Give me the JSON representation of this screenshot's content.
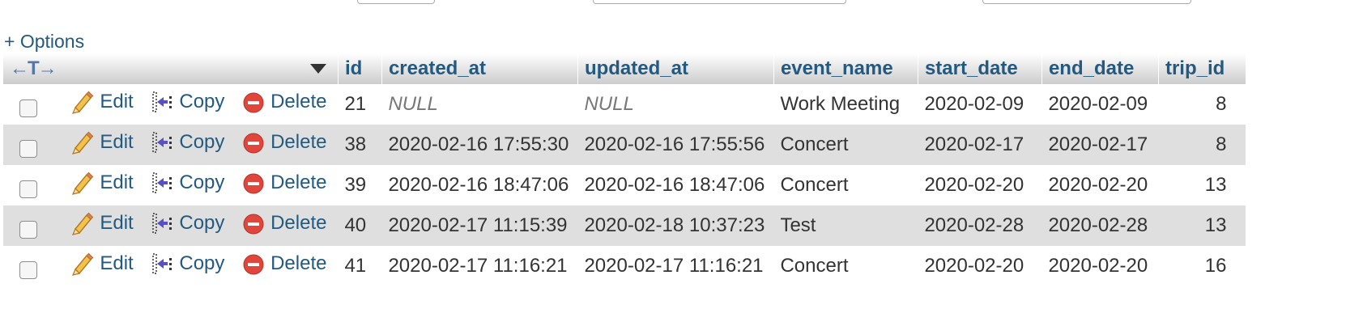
{
  "options_label": "+ Options",
  "headers": {
    "id": "id",
    "created_at": "created_at",
    "updated_at": "updated_at",
    "event_name": "event_name",
    "start_date": "start_date",
    "end_date": "end_date",
    "trip_id": "trip_id"
  },
  "actions": {
    "edit": "Edit",
    "copy": "Copy",
    "delete": "Delete"
  },
  "rows": [
    {
      "id": "21",
      "created_at": "NULL",
      "updated_at": "NULL",
      "event_name": "Work Meeting",
      "start_date": "2020-02-09",
      "end_date": "2020-02-09",
      "trip_id": "8"
    },
    {
      "id": "38",
      "created_at": "2020-02-16 17:55:30",
      "updated_at": "2020-02-16 17:55:56",
      "event_name": "Concert",
      "start_date": "2020-02-17",
      "end_date": "2020-02-17",
      "trip_id": "8"
    },
    {
      "id": "39",
      "created_at": "2020-02-16 18:47:06",
      "updated_at": "2020-02-16 18:47:06",
      "event_name": "Concert",
      "start_date": "2020-02-20",
      "end_date": "2020-02-20",
      "trip_id": "13"
    },
    {
      "id": "40",
      "created_at": "2020-02-17 11:15:39",
      "updated_at": "2020-02-18 10:37:23",
      "event_name": "Test",
      "start_date": "2020-02-28",
      "end_date": "2020-02-28",
      "trip_id": "13"
    },
    {
      "id": "41",
      "created_at": "2020-02-17 11:16:21",
      "updated_at": "2020-02-17 11:16:21",
      "event_name": "Concert",
      "start_date": "2020-02-20",
      "end_date": "2020-02-20",
      "trip_id": "16"
    }
  ],
  "icons": {
    "edit": "pencil-icon",
    "copy": "copy-row-icon",
    "delete": "delete-circle-icon",
    "column_resize": "column-arrows-icon",
    "sort_menu": "dropdown-triangle-icon"
  },
  "colors": {
    "link": "#235a81",
    "row_alt": "#dfdfdf",
    "delete": "#e0463b"
  }
}
